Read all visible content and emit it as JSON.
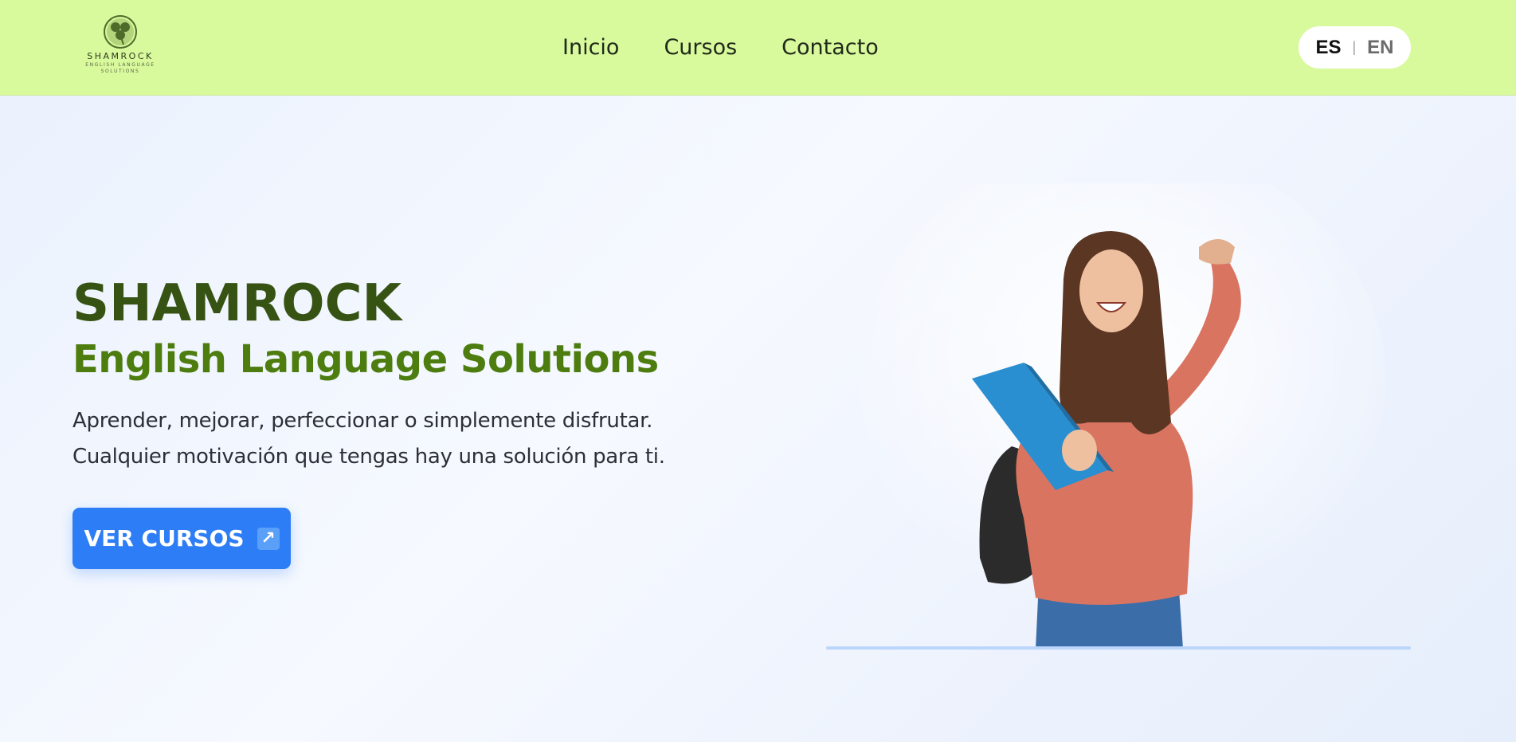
{
  "header": {
    "logo": {
      "name": "SHAMROCK",
      "tagline_line1": "ENGLISH LANGUAGE",
      "tagline_line2": "SOLUTIONS",
      "icon": "shamrock-icon"
    },
    "nav": [
      {
        "label": "Inicio"
      },
      {
        "label": "Cursos"
      },
      {
        "label": "Contacto"
      }
    ],
    "language": {
      "options": [
        "ES",
        "EN"
      ],
      "selected": "ES",
      "separator": "|"
    }
  },
  "hero": {
    "title": "SHAMROCK",
    "subtitle": "English Language Solutions",
    "description_line1": "Aprender, mejorar, perfeccionar o simplemente disfrutar.",
    "description_line2": "Cualquier motivación que tengas hay una solución para ti.",
    "cta": {
      "label": "VER CURSOS",
      "icon": "external-arrow-icon",
      "arrow_glyph": "↗"
    },
    "image": "student-photo"
  },
  "colors": {
    "header_bg": "#d9f99d",
    "title": "#365314",
    "subtitle": "#4d7c0f",
    "cta_bg": "#2d7df6",
    "accent_line": "#bcd6fb"
  }
}
